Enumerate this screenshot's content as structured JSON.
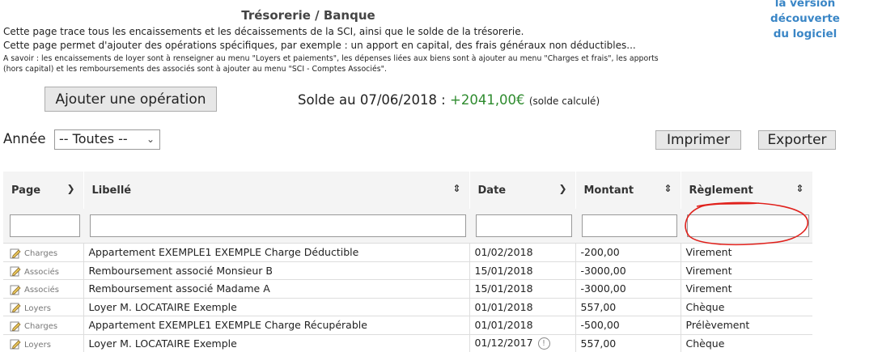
{
  "promo": {
    "lines": [
      "la version",
      "découverte",
      "du logiciel"
    ]
  },
  "header": {
    "title": "Trésorerie / Banque",
    "desc1": "Cette page trace tous les encaissements et les décaissements de la SCI, ainsi que le solde de la trésorerie.",
    "desc2": "Cette page permet d'ajouter des opérations spécifiques, par exemple : un apport en capital, des frais généraux non déductibles...",
    "note1": "A savoir : les encaissements de loyer sont à renseigner au menu \"Loyers et paiements\", les dépenses liées aux biens sont à ajouter au menu \"Charges et frais\", les apports",
    "note2": "(hors capital) et les remboursements des associés sont à ajouter au menu \"SCI - Comptes Associés\"."
  },
  "toolbar": {
    "add_label": "Ajouter une opération",
    "balance_prefix": "Solde au 07/06/2018 : ",
    "balance_amount": "+2041,00€",
    "balance_note": "(solde calculé)",
    "year_label": "Année",
    "year_value": "-- Toutes --",
    "print_label": "Imprimer",
    "export_label": "Exporter"
  },
  "table": {
    "columns": [
      "Page",
      "Libellé",
      "Date",
      "Montant",
      "Règlement"
    ],
    "rows": [
      {
        "page": "Charges",
        "label": "Appartement EXEMPLE1 EXEMPLE Charge Déductible",
        "date": "01/02/2018",
        "amount": "-200,00",
        "payment": "Virement"
      },
      {
        "page": "Associés",
        "label": "Remboursement associé Monsieur B",
        "date": "15/01/2018",
        "amount": "-3000,00",
        "payment": "Virement"
      },
      {
        "page": "Associés",
        "label": "Remboursement associé Madame A",
        "date": "15/01/2018",
        "amount": "-3000,00",
        "payment": "Virement"
      },
      {
        "page": "Loyers",
        "label": "Loyer M. LOCATAIRE Exemple",
        "date": "01/01/2018",
        "amount": "557,00",
        "payment": "Chèque"
      },
      {
        "page": "Charges",
        "label": "Appartement EXEMPLE1 EXEMPLE Charge Récupérable",
        "date": "01/01/2018",
        "amount": "-500,00",
        "payment": "Prélèvement"
      },
      {
        "page": "Loyers",
        "label": "Loyer M. LOCATAIRE Exemple",
        "date": "01/12/2017",
        "amount": "557,00",
        "payment": "Chèque"
      }
    ]
  },
  "colors": {
    "accent": "#3a86c6",
    "positive": "#2e8b2e",
    "annotation": "#e0201b"
  }
}
